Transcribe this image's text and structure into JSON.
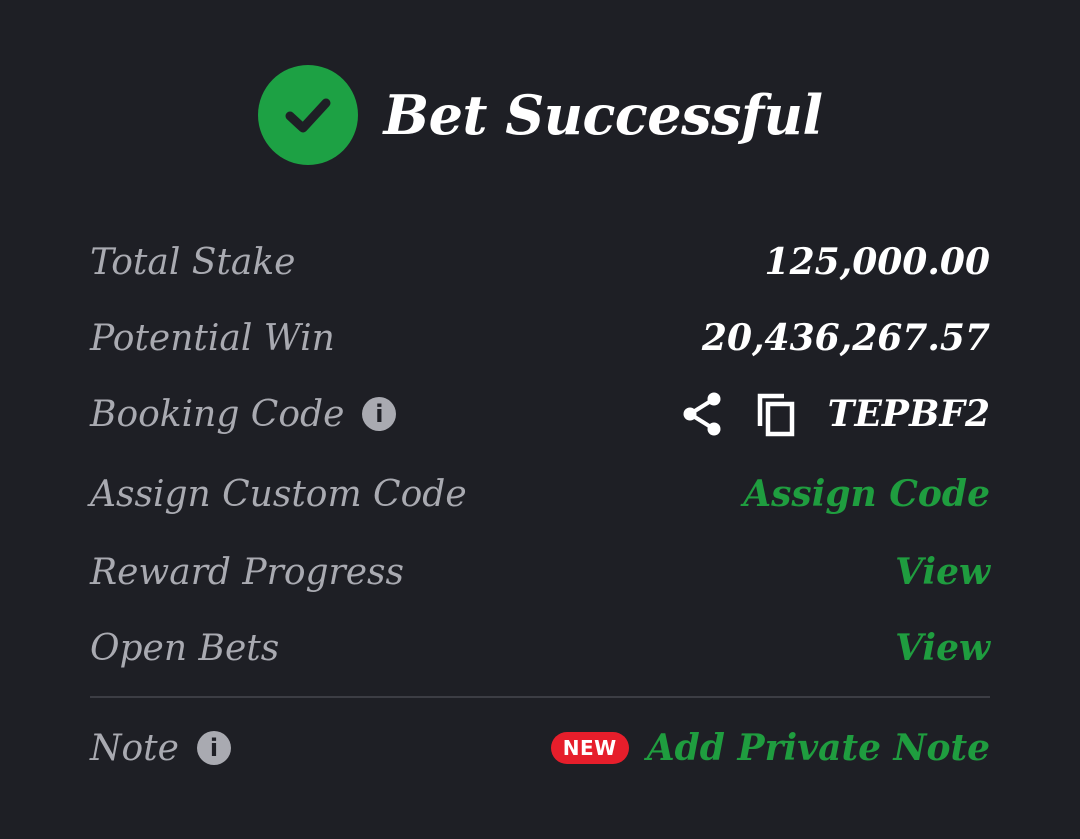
{
  "header": {
    "title": "Bet Successful",
    "icon": "check-circle-icon",
    "accent_color": "#1da144"
  },
  "rows": {
    "total_stake": {
      "label": "Total Stake",
      "value": "125,000.00"
    },
    "potential_win": {
      "label": "Potential Win",
      "value": "20,436,267.57"
    },
    "booking_code": {
      "label": "Booking Code",
      "value": "TEPBF2",
      "info_icon": "info-icon",
      "share_icon": "share-icon",
      "copy_icon": "copy-icon"
    },
    "assign_custom_code": {
      "label": "Assign Custom Code",
      "action": "Assign Code"
    },
    "reward_progress": {
      "label": "Reward Progress",
      "action": "View"
    },
    "open_bets": {
      "label": "Open Bets",
      "action": "View"
    },
    "note": {
      "label": "Note",
      "badge": "NEW",
      "action": "Add Private Note",
      "info_icon": "info-icon"
    }
  },
  "colors": {
    "background": "#1e1f25",
    "link": "#1f9d3f",
    "badge": "#e61e2b"
  }
}
